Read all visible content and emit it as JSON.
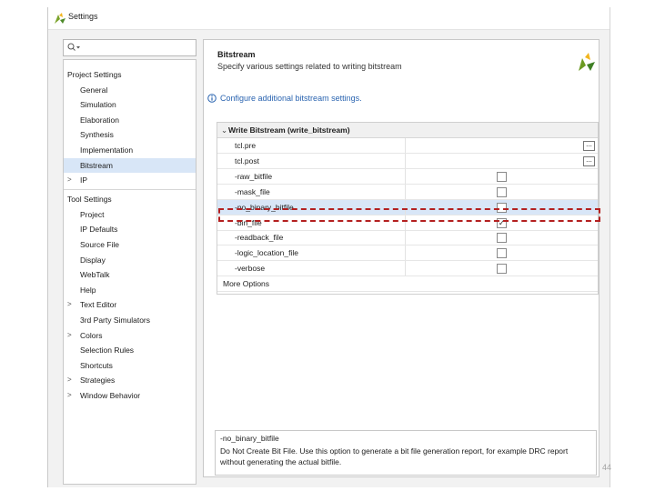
{
  "window": {
    "title": "Settings"
  },
  "left": {
    "search_placeholder": "Q▾",
    "project_settings": {
      "header": "Project Settings",
      "items": [
        "General",
        "Simulation",
        "Elaboration",
        "Synthesis",
        "Implementation",
        "Bitstream"
      ],
      "selected": "Bitstream",
      "ip": "IP"
    },
    "tool_settings": {
      "header": "Tool Settings",
      "items": [
        {
          "label": "Project",
          "expandable": false
        },
        {
          "label": "IP Defaults",
          "expandable": false
        },
        {
          "label": "Source File",
          "expandable": false
        },
        {
          "label": "Display",
          "expandable": false
        },
        {
          "label": "WebTalk",
          "expandable": false
        },
        {
          "label": "Help",
          "expandable": false
        },
        {
          "label": "Text Editor",
          "expandable": true
        },
        {
          "label": "3rd Party Simulators",
          "expandable": false
        },
        {
          "label": "Colors",
          "expandable": true
        },
        {
          "label": "Selection Rules",
          "expandable": false
        },
        {
          "label": "Shortcuts",
          "expandable": false
        },
        {
          "label": "Strategies",
          "expandable": true
        },
        {
          "label": "Window Behavior",
          "expandable": true
        }
      ]
    }
  },
  "right": {
    "title": "Bitstream",
    "subtitle": "Specify various settings related to writing bitstream",
    "info_link": "Configure additional bitstream settings.",
    "group": "Write Bitstream (write_bitstream)",
    "rows": [
      {
        "name": "tcl.pre",
        "control": "dots"
      },
      {
        "name": "tcl.post",
        "control": "dots"
      },
      {
        "name": "-raw_bitfile",
        "control": "checkbox",
        "checked": false
      },
      {
        "name": "-mask_file",
        "control": "checkbox",
        "checked": false
      },
      {
        "name": "-no_binary_bitfile",
        "control": "checkbox",
        "checked": false,
        "selected": true
      },
      {
        "name": "-bin_file",
        "control": "checkbox",
        "checked": true
      },
      {
        "name": "-readback_file",
        "control": "checkbox",
        "checked": false
      },
      {
        "name": "-logic_location_file",
        "control": "checkbox",
        "checked": false
      },
      {
        "name": "-verbose",
        "control": "checkbox",
        "checked": false
      },
      {
        "name": "More Options",
        "control": "none",
        "full": true
      }
    ],
    "description": {
      "title": "-no_binary_bitfile",
      "text": "Do Not Create Bit File. Use this option to generate a bit file generation report, for example DRC report without generating the actual bitfile."
    }
  },
  "page_number": "44",
  "colors": {
    "selection": "#d8e6f7",
    "highlight": "#b42020",
    "link": "#2a64b0"
  }
}
